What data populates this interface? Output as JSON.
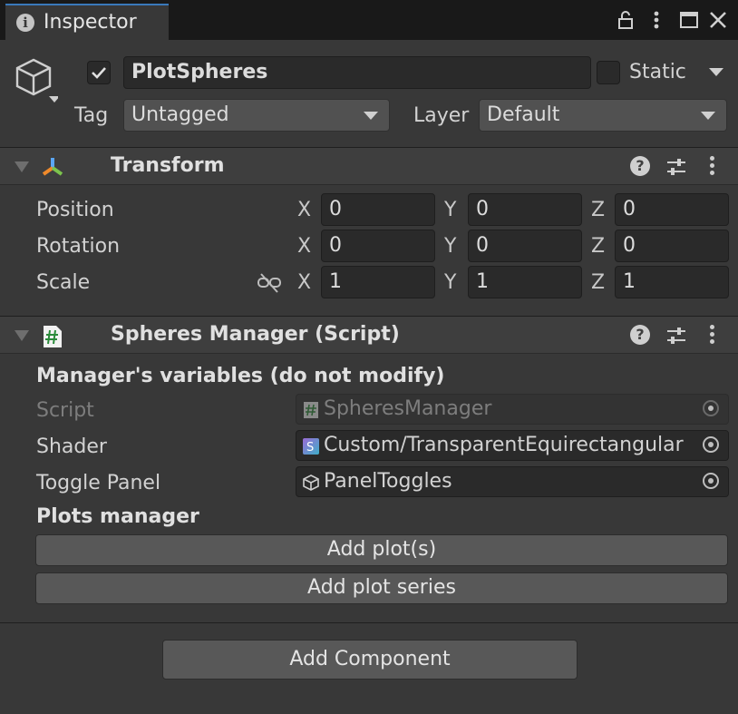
{
  "tab": {
    "title": "Inspector",
    "icon": "info-icon"
  },
  "window_controls": [
    "lock-icon",
    "more-vertical-icon",
    "maximize-icon",
    "close-icon"
  ],
  "header": {
    "active": true,
    "name": "PlotSpheres",
    "static_label": "Static",
    "static_checked": false,
    "tag_label": "Tag",
    "tag_value": "Untagged",
    "layer_label": "Layer",
    "layer_value": "Default"
  },
  "transform": {
    "title": "Transform",
    "rows": [
      {
        "label": "Position",
        "x": "0",
        "y": "0",
        "z": "0"
      },
      {
        "label": "Rotation",
        "x": "0",
        "y": "0",
        "z": "0"
      },
      {
        "label": "Scale",
        "x": "1",
        "y": "1",
        "z": "1"
      }
    ],
    "axis_labels": {
      "x": "X",
      "y": "Y",
      "z": "Z"
    }
  },
  "spheres_manager": {
    "title": "Spheres Manager (Script)",
    "section1": "Manager's variables (do not modify)",
    "fields": [
      {
        "label": "Script",
        "value": "SpheresManager",
        "icon": "script-icon",
        "disabled": true
      },
      {
        "label": "Shader",
        "value": "Custom/TransparentEquirectangular",
        "icon": "shader-icon",
        "disabled": false
      },
      {
        "label": "Toggle Panel",
        "value": "PanelToggles",
        "icon": "prefab-cube-icon",
        "disabled": false
      }
    ],
    "section2": "Plots manager",
    "buttons": [
      "Add plot(s)",
      "Add plot series"
    ]
  },
  "add_component": "Add Component",
  "colors": {
    "background": "#383838",
    "tabbar": "#191919",
    "accent": "#3a79bb",
    "field": "#2a2a2a",
    "button": "#585858"
  }
}
